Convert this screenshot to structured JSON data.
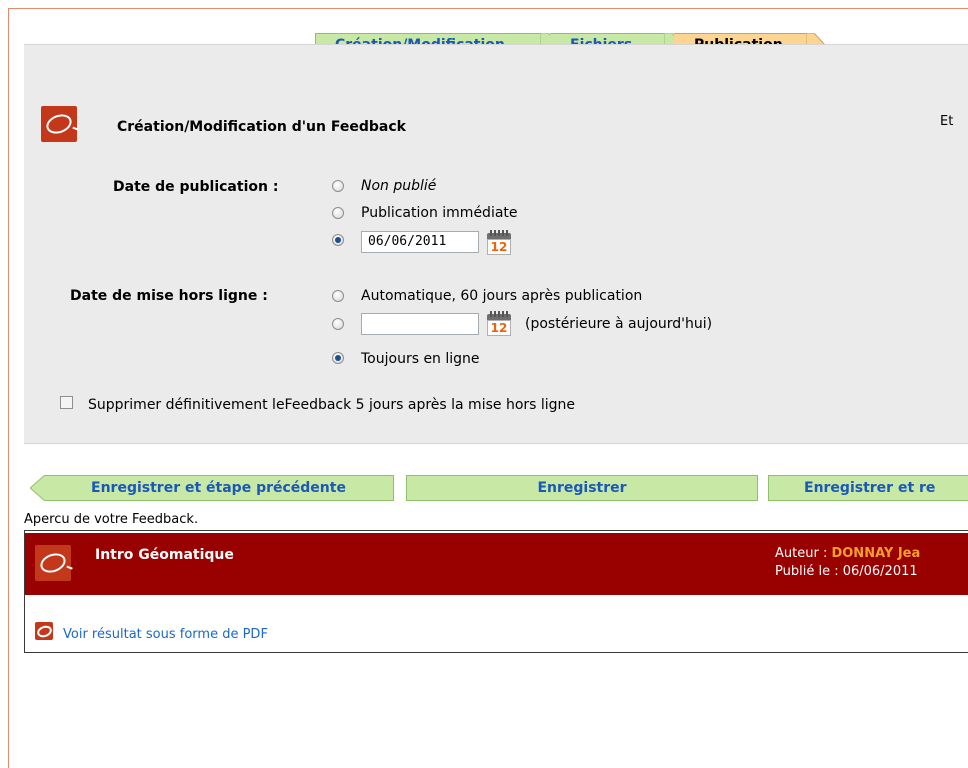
{
  "steps": [
    {
      "label": "Création/Modification",
      "state": "done"
    },
    {
      "label": "Fichiers",
      "state": "done"
    },
    {
      "label": "Publication",
      "state": "active"
    }
  ],
  "form": {
    "title": "Création/Modification d'un Feedback",
    "right_cut_text": "Et",
    "publication": {
      "label": "Date de publication :",
      "options": [
        "Non publié",
        "Publication immédiate"
      ],
      "selected_option": "date",
      "date_value": "06/06/2011",
      "calendar_day": "12"
    },
    "offline": {
      "label": "Date de mise hors ligne :",
      "option_auto": "Automatique, 60 jours après publication",
      "date_value": "",
      "date_hint": "(postérieure à aujourd'hui)",
      "option_always": "Toujours en ligne",
      "selected_option": "always",
      "calendar_day": "12"
    },
    "delete_checkbox": {
      "label": "Supprimer définitivement leFeedback 5 jours après la mise hors ligne",
      "checked": false
    }
  },
  "actions": {
    "prev": "Enregistrer et étape précédente",
    "save": "Enregistrer",
    "next": "Enregistrer et re"
  },
  "preview": {
    "caption": "Apercu de votre Feedback.",
    "title": "Intro Géomatique",
    "author_label": "Auteur : ",
    "author_name": "DONNAY Jea",
    "published": "Publié le : 06/06/2011",
    "pdf_link": "Voir résultat sous forme de PDF"
  },
  "colors": {
    "step_green": "#c8e8a6",
    "step_active": "#fcd592",
    "link_blue": "#1b58b8",
    "header_red": "#990000",
    "author_orange": "#f2a02a"
  }
}
